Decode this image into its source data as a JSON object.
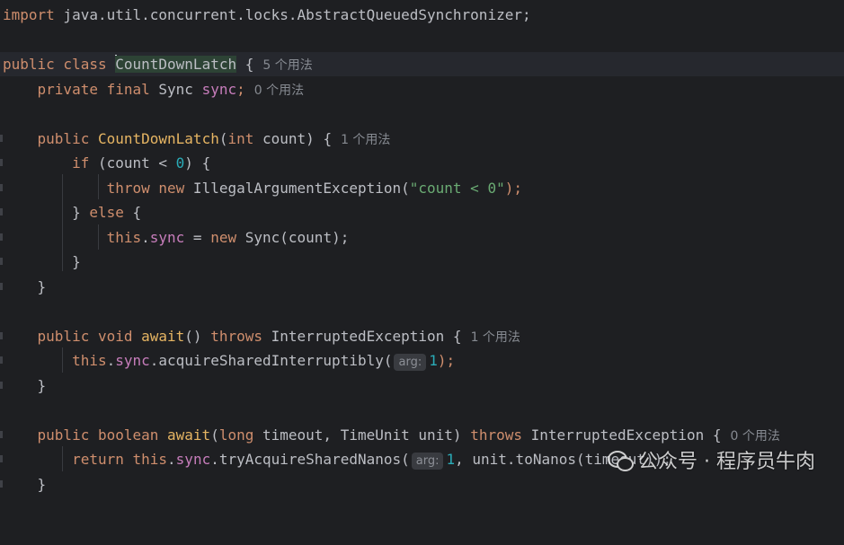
{
  "editor": {
    "lines": {
      "import": {
        "kw": "import",
        "text": " java.util.concurrent.locks.AbstractQueuedSynchronizer;"
      },
      "class_decl": {
        "kw": "public class",
        "name": "CountDownLatch",
        "brace": " {",
        "usages": "5 个用法"
      },
      "field": {
        "kw": "private final",
        "type": " Sync ",
        "name": "sync",
        "semi": ";",
        "usages": "0 个用法"
      },
      "ctor": {
        "kw": "public",
        "name": "CountDownLatch",
        "open": "(",
        "type_kw": "int",
        "params": " count) {",
        "usages": "1 个用法"
      },
      "if_line": {
        "kw": "if",
        "cond": " (count < ",
        "num": "0",
        "close": ") {"
      },
      "throw_line": {
        "kw1": "throw",
        "kw2": " new",
        "text": " IllegalArgumentException(",
        "str": "\"count < 0\"",
        "close": ");"
      },
      "else_line": {
        "brace": "} ",
        "kw": "else",
        "open": " {"
      },
      "assign_line": {
        "kw_this": "this",
        "dot": ".",
        "field": "sync",
        "mid": " = ",
        "kw_new": "new",
        "text": " Sync(count);"
      },
      "close_if": "}",
      "close_ctor": "}",
      "await1": {
        "kw": "public void",
        "name": " await",
        "sig": "() ",
        "throws": "throws",
        "exc": " InterruptedException {",
        "usages": "1 个用法"
      },
      "await1_body": {
        "kw_this": "this",
        "dot": ".",
        "field": "sync",
        "call": ".acquireSharedInterruptibly(",
        "hint": "arg:",
        "num": "1",
        "close": ");"
      },
      "close_await1": "}",
      "await2": {
        "kw": "public boolean",
        "name": " await",
        "open": "(",
        "type_kw": "long",
        "params": " timeout, TimeUnit unit) ",
        "throws": "throws",
        "exc": " InterruptedException {",
        "usages": "0 个用法"
      },
      "await2_body": {
        "kw_ret": "return",
        "kw_this": " this",
        "dot": ".",
        "field": "sync",
        "call": ".tryAcquireSharedNanos(",
        "hint": "arg:",
        "num": "1",
        "rest": ", unit.toNanos(timeout));"
      },
      "close_await2": "}"
    }
  },
  "watermark": {
    "text": "公众号 · 程序员牛肉"
  }
}
